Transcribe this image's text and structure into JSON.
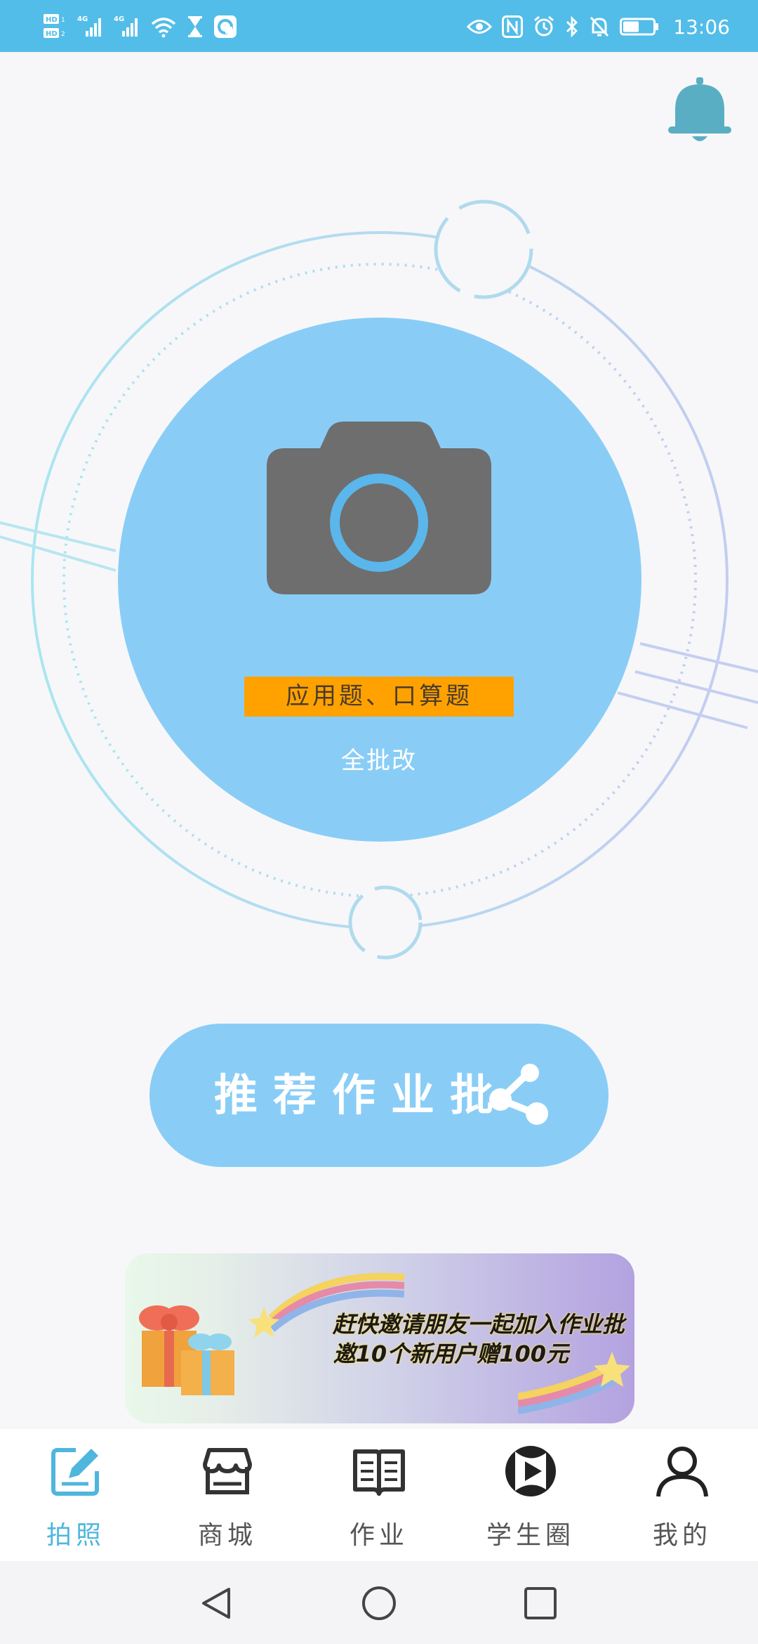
{
  "status_bar": {
    "time": "13:06",
    "signal_label_1": "4G",
    "signal_label_2": "4G",
    "hd_label_1": "HD",
    "hd_label_2": "HD",
    "icons": [
      "signal-icon",
      "wifi-icon",
      "hourglass-icon",
      "app-icon",
      "eye-icon",
      "nfc-icon",
      "alarm-icon",
      "bluetooth-icon",
      "mute-icon",
      "battery-icon"
    ]
  },
  "main": {
    "camera_tag": "应用题、口算题",
    "camera_sub": "全批改",
    "recommend_label": "推荐作业批"
  },
  "banner": {
    "line1": "赶快邀请朋友一起加入作业批",
    "line2": "邀10个新用户赠100元"
  },
  "tabs": [
    {
      "label": "拍照",
      "icon": "edit-icon",
      "active": true
    },
    {
      "label": "商城",
      "icon": "store-icon",
      "active": false
    },
    {
      "label": "作业",
      "icon": "book-icon",
      "active": false
    },
    {
      "label": "学生圈",
      "icon": "play-circle-icon",
      "active": false
    },
    {
      "label": "我的",
      "icon": "user-icon",
      "active": false
    }
  ],
  "colors": {
    "status_bar": "#52bde8",
    "accent": "#89cdf7",
    "tag_bg": "#ffa200",
    "active_tab": "#4fb6de",
    "bell": "#5aaec4"
  }
}
